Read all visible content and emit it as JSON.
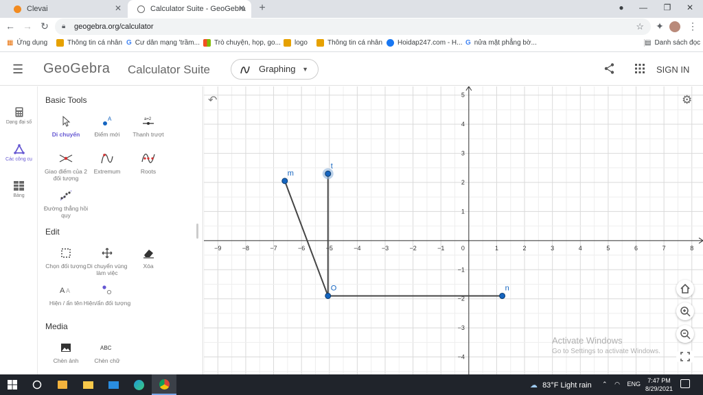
{
  "browser": {
    "tabs": [
      {
        "title": "Clevai",
        "icon_color": "#f28b20"
      },
      {
        "title": "Calculator Suite - GeoGebra",
        "icon_color": "#666666"
      }
    ],
    "url": "geogebra.org/calculator",
    "bookmarks": [
      {
        "label": "Ứng dụng",
        "icon": "apps-grid-icon",
        "color": "#e8710a"
      },
      {
        "label": "Thông tin cá nhân",
        "icon": "h-logo-icon",
        "color": "#e6a100"
      },
      {
        "label": "Cư dân mạng 'trầm...",
        "icon": "google-icon",
        "color": "#4285f4"
      },
      {
        "label": "Trò chuyện, họp, go...",
        "icon": "microsoft-icon",
        "color": "#f25022"
      },
      {
        "label": "logo",
        "icon": "h-logo-icon",
        "color": "#e6a100"
      },
      {
        "label": "Thông tin cá nhân",
        "icon": "h-logo-icon",
        "color": "#e6a100"
      },
      {
        "label": "Hoidap247.com - H...",
        "icon": "facebook-icon",
        "color": "#1877f2"
      },
      {
        "label": "nửa mặt phẳng bờ...",
        "icon": "google-icon",
        "color": "#4285f4"
      }
    ],
    "reading_list": "Danh sách đọc"
  },
  "header": {
    "logo": "GeoGebra",
    "suite": "Calculator Suite",
    "app_select": "Graphing",
    "signin": "SIGN IN"
  },
  "rail": [
    {
      "label": "Dạng đại số",
      "icon": "calculator-icon"
    },
    {
      "label": "Các công cụ",
      "icon": "tools-triangle-icon"
    },
    {
      "label": "Bảng",
      "icon": "table-icon"
    }
  ],
  "tools": {
    "basic_title": "Basic Tools",
    "basic": [
      "Di chuyển",
      "Điểm mới",
      "Thanh trượt",
      "Giao điểm của 2 đối tượng",
      "Extremum",
      "Roots",
      "Đường thẳng hồi quy"
    ],
    "edit_title": "Edit",
    "edit": [
      "Chọn đối tượng",
      "Di chuyển vùng làm việc",
      "Xóa",
      "Hiện / ẩn tên",
      "Hiện/ẩn đối tượng"
    ],
    "media_title": "Media",
    "media": [
      "Chèn ảnh",
      "Chèn chữ"
    ]
  },
  "chart_data": {
    "type": "scatter",
    "x_range": [
      -9.5,
      8.4
    ],
    "y_range": [
      -4.6,
      5.3
    ],
    "x_ticks": [
      -9,
      -8,
      -7,
      -6,
      -5,
      -4,
      -3,
      -2,
      -1,
      1,
      2,
      3,
      4,
      5,
      6,
      7,
      8
    ],
    "y_ticks": [
      -4,
      -3,
      -2,
      -1,
      1,
      2,
      3,
      4,
      5
    ],
    "origin_label": "0",
    "grid": true,
    "points": [
      {
        "name": "m",
        "x": -6.6,
        "y": 2.05
      },
      {
        "name": "t",
        "x": -5.05,
        "y": 2.3,
        "selected": true
      },
      {
        "name": "O",
        "x": -5.05,
        "y": -1.9
      },
      {
        "name": "n",
        "x": 1.2,
        "y": -1.9
      }
    ],
    "segments": [
      [
        "m",
        "O"
      ],
      [
        "t",
        "O"
      ],
      [
        "O",
        "n"
      ]
    ],
    "point_color": "#1565c0",
    "segment_color": "#444444"
  },
  "watermark": {
    "line1": "Activate Windows",
    "line2": "Go to Settings to activate Windows."
  },
  "taskbar": {
    "weather": "83°F  Light rain",
    "lang": "ENG",
    "time": "7:47 PM",
    "date": "8/29/2021"
  }
}
